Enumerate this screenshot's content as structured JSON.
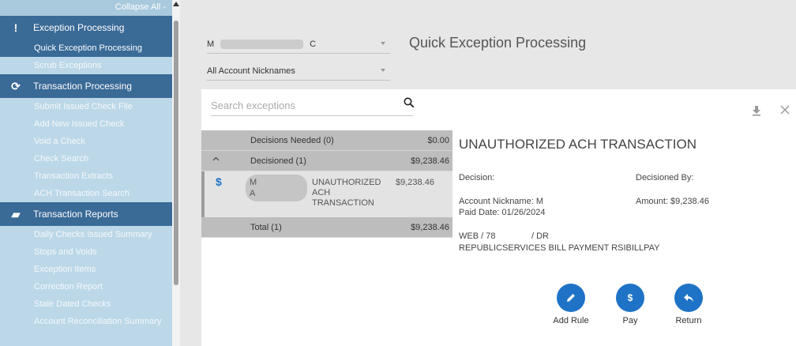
{
  "sidebar": {
    "collapse_label": "Collapse All -",
    "sections": [
      {
        "title": "Exception Processing",
        "icon": "exclamation-icon",
        "icon_glyph": "!",
        "items": [
          {
            "label": "Quick Exception Processing",
            "active": true
          },
          {
            "label": "Scrub Exceptions",
            "active": false
          }
        ]
      },
      {
        "title": "Transaction Processing",
        "icon": "refresh-icon",
        "icon_glyph": "⟳",
        "items": [
          {
            "label": "Submit Issued Check File"
          },
          {
            "label": "Add New Issued Check"
          },
          {
            "label": "Void a Check"
          },
          {
            "label": "Check Search"
          },
          {
            "label": "Transaction Extracts"
          },
          {
            "label": "ACH Transaction Search"
          }
        ]
      },
      {
        "title": "Transaction Reports",
        "icon": "folder-open-icon",
        "icon_glyph": "▰",
        "items": [
          {
            "label": "Daily Checks Issued Summary"
          },
          {
            "label": "Stops and Voids"
          },
          {
            "label": "Exception Items"
          },
          {
            "label": "Correction Report"
          },
          {
            "label": "Stale Dated Checks"
          },
          {
            "label": "Account Reconciliation Summary"
          }
        ]
      }
    ]
  },
  "main": {
    "account_select": {
      "prefix": "M",
      "suffix": "C"
    },
    "nickname_select": "All Account Nicknames",
    "page_title": "Quick Exception Processing"
  },
  "panel": {
    "search_placeholder": "Search exceptions",
    "list": {
      "decisions_needed": {
        "label": "Decisions Needed (0)",
        "amount": "$0.00"
      },
      "decisioned": {
        "label": "Decisioned (1)",
        "amount": "$9,238.46"
      },
      "item": {
        "name_line1": "M",
        "name_line2": "A",
        "type_line1": "UNAUTHORIZED",
        "type_line2": "ACH",
        "type_line3": "TRANSACTION",
        "amount": "$9,238.46"
      },
      "total": {
        "label": "Total (1)",
        "amount": "$9,238.46"
      }
    },
    "detail": {
      "title": "UNAUTHORIZED ACH TRANSACTION",
      "decision_label": "Decision:",
      "decisioned_by_label": "Decisioned By:",
      "account_nickname": "Account Nickname:  M",
      "amount": "Amount:  $9,238.46",
      "paid_date": "Paid Date:  01/26/2024",
      "web_line_a": "WEB / 78",
      "web_line_b": "/ DR",
      "description": "REPUBLICSERVICES BILL PAYMENT RSIBILLPAY"
    },
    "actions": {
      "add_rule": "Add Rule",
      "pay": "Pay",
      "pay_glyph": "$",
      "return": "Return"
    }
  },
  "colors": {
    "sidebar_bg": "#bcd8e8",
    "sidebar_header": "#3a6a96",
    "accent_blue": "#1f73c6"
  }
}
